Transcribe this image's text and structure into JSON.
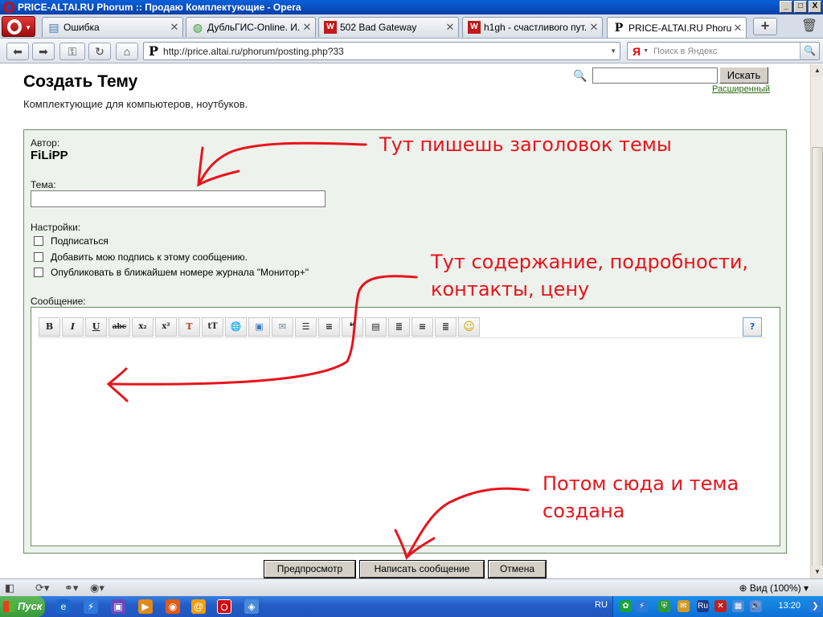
{
  "window": {
    "title": "PRICE-ALTAI.RU Phorum :: Продаю Комплектующие - Opera",
    "controls": [
      "_",
      "□",
      "X"
    ]
  },
  "tabs": [
    {
      "label": "Ошибка",
      "icon": "page-icon",
      "active": false
    },
    {
      "label": "ДубльГИС-Online. И...",
      "icon": "2gis-icon",
      "active": false
    },
    {
      "label": "502 Bad Gateway",
      "icon": "red-w-icon",
      "active": false
    },
    {
      "label": "h1gh - счастливого пут...",
      "icon": "red-w-icon",
      "active": false
    },
    {
      "label": "PRICE-ALTAI.RU Phoru...",
      "icon": "p-icon",
      "active": true
    }
  ],
  "address": {
    "url": "http://price.altai.ru/phorum/posting.php?33",
    "site_icon": "Р",
    "search_engine": "Я",
    "search_placeholder": "Поиск в Яндекс"
  },
  "page": {
    "title": "Создать Тему",
    "subtitle": "Комплектующие для компьютеров, ноутбуков.",
    "search": {
      "button": "Искать",
      "advanced": "Расширенный",
      "value": ""
    },
    "form": {
      "author_label": "Автор:",
      "author": "FiLiPP",
      "subject_label": "Тема:",
      "subject_value": "",
      "settings_label": "Настройки:",
      "options": [
        "Подписаться",
        "Добавить мою подпись к этому сообщению.",
        "Опубликовать в ближайшем номере журнала \"Монитор+\""
      ],
      "message_label": "Сообщение:",
      "toolbar": [
        {
          "name": "bold",
          "glyph": "B"
        },
        {
          "name": "italic",
          "glyph": "I"
        },
        {
          "name": "underline",
          "glyph": "U"
        },
        {
          "name": "strikethrough",
          "glyph": "abc"
        },
        {
          "name": "subscript",
          "glyph": "x₂"
        },
        {
          "name": "superscript",
          "glyph": "x²"
        },
        {
          "name": "text-color",
          "glyph": "T"
        },
        {
          "name": "text-size",
          "glyph": "tT"
        },
        {
          "name": "link",
          "glyph": "🌐"
        },
        {
          "name": "image",
          "glyph": "▣"
        },
        {
          "name": "email",
          "glyph": "✉"
        },
        {
          "name": "list",
          "glyph": "☰"
        },
        {
          "name": "ordered-list",
          "glyph": "≡"
        },
        {
          "name": "quote",
          "glyph": "❝"
        },
        {
          "name": "code",
          "glyph": "▤"
        },
        {
          "name": "align-left",
          "glyph": "≣"
        },
        {
          "name": "align-center",
          "glyph": "≡"
        },
        {
          "name": "align-right",
          "glyph": "≣"
        },
        {
          "name": "smiley",
          "glyph": "☺"
        }
      ],
      "help_glyph": "?",
      "message_value": ""
    },
    "buttons": {
      "preview": "Предпросмотр",
      "submit": "Написать сообщение",
      "cancel": "Отмена"
    },
    "annotations": {
      "subject_note": "Тут пишешь заголовок темы",
      "message_note_1": "Тут содержание, подробности,",
      "message_note_2": "контакты, цену",
      "submit_note_1": "Потом сюда и тема",
      "submit_note_2": "создана"
    }
  },
  "statusbar": {
    "zoom": "Вид (100%)"
  },
  "taskbar": {
    "start": "Пуск",
    "language": "RU",
    "clock": "13:20"
  },
  "colors": {
    "annotation": "#e8141c",
    "form_bg": "#edf2ec",
    "form_border": "#6b8c63",
    "link": "#2a6a14"
  }
}
